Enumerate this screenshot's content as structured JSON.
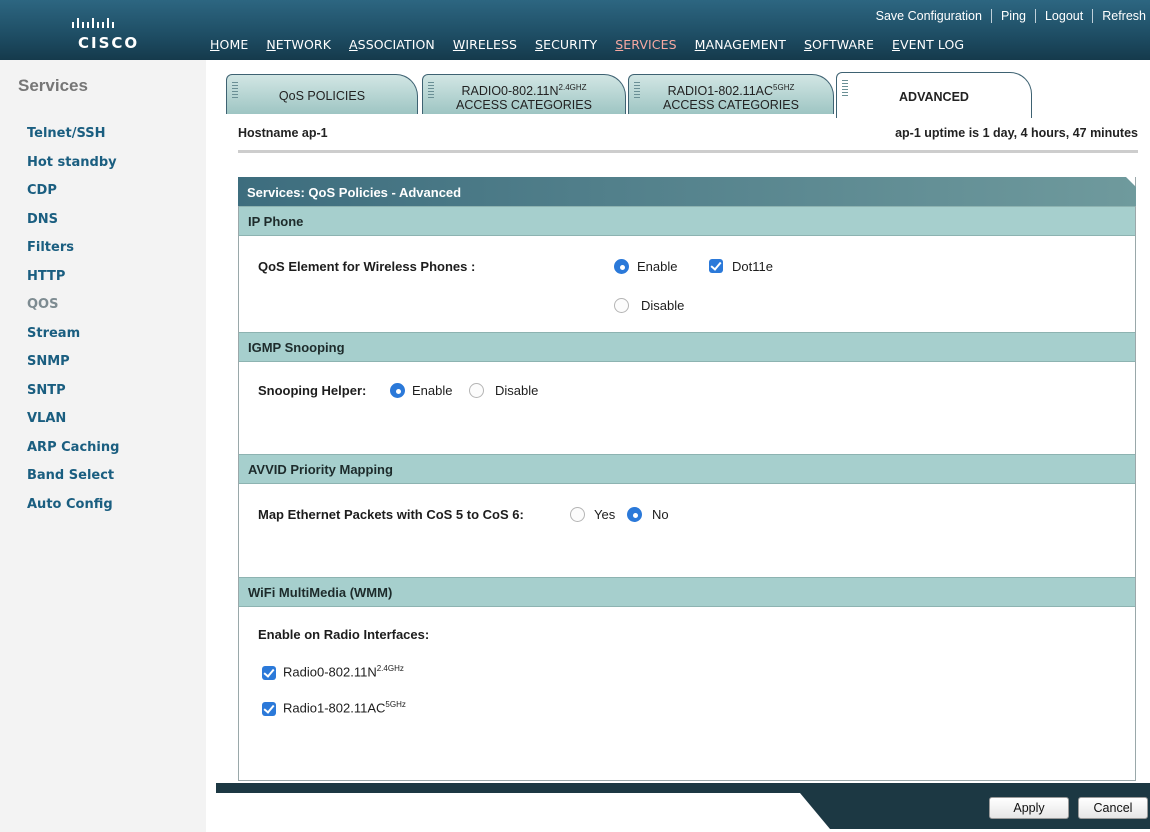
{
  "brand": {
    "logo_text": "CISCO"
  },
  "top_links": [
    "Save Configuration",
    "Ping",
    "Logout",
    "Refresh"
  ],
  "nav": {
    "items": [
      "HOME",
      "NETWORK",
      "ASSOCIATION",
      "WIRELESS",
      "SECURITY",
      "SERVICES",
      "MANAGEMENT",
      "SOFTWARE",
      "EVENT LOG"
    ],
    "active": "SERVICES"
  },
  "sidebar": {
    "title": "Services",
    "items": [
      "Telnet/SSH",
      "Hot standby",
      "CDP",
      "DNS",
      "Filters",
      "HTTP",
      "QOS",
      "Stream",
      "SNMP",
      "SNTP",
      "VLAN",
      "ARP Caching",
      "Band Select",
      "Auto Config"
    ],
    "active": "QOS"
  },
  "tabs": [
    {
      "line1": "QoS POLICIES",
      "line2": ""
    },
    {
      "line1": "RADIO0-802.11N",
      "sup": "2.4GHZ",
      "line2": "ACCESS CATEGORIES"
    },
    {
      "line1": "RADIO1-802.11AC",
      "sup": "5GHZ",
      "line2": "ACCESS CATEGORIES"
    },
    {
      "line1": "ADVANCED",
      "line2": "",
      "active": true
    }
  ],
  "host": {
    "hostname": "Hostname  ap-1",
    "uptime": "ap-1 uptime is 1 day, 4 hours, 47 minutes"
  },
  "panel_title": "Services: QoS Policies - Advanced",
  "ip_phone": {
    "heading": "IP Phone",
    "label": "QoS Element for Wireless Phones :",
    "enable": "Enable",
    "dot11e": "Dot11e",
    "disable": "Disable",
    "selected": "Enable",
    "dot11e_checked": true
  },
  "igmp": {
    "heading": "IGMP Snooping",
    "label": "Snooping Helper:",
    "enable": "Enable",
    "disable": "Disable",
    "selected": "Enable"
  },
  "avvid": {
    "heading": "AVVID Priority Mapping",
    "label": "Map Ethernet Packets with CoS 5 to CoS 6:",
    "yes": "Yes",
    "no": "No",
    "selected": "No"
  },
  "wmm": {
    "heading": "WiFi MultiMedia (WMM)",
    "label": "Enable on Radio Interfaces:",
    "radios": [
      {
        "name": "Radio0-802.11N",
        "sup": "2.4GHz",
        "checked": true
      },
      {
        "name": "Radio1-802.11AC",
        "sup": "5GHz",
        "checked": true
      }
    ]
  },
  "buttons": {
    "apply": "Apply",
    "cancel": "Cancel"
  }
}
